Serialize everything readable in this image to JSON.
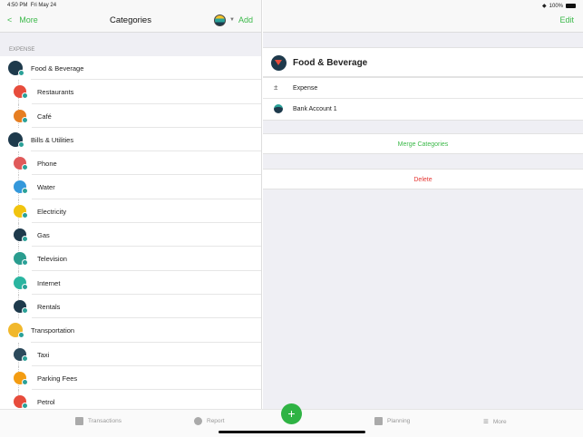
{
  "status": {
    "time": "4:50 PM",
    "date": "Fri May 24",
    "battery": "100%"
  },
  "nav": {
    "back_label": "More",
    "title": "Categories",
    "add_label": "Add",
    "edit_label": "Edit"
  },
  "section_label": "EXPENSE",
  "categories": [
    {
      "label": "Food & Beverage",
      "level": "parent",
      "color": "#1e3a4c"
    },
    {
      "label": "Restaurants",
      "level": "child",
      "color": "#e74c3c"
    },
    {
      "label": "Café",
      "level": "child",
      "color": "#e67e22"
    },
    {
      "label": "Bills & Utilities",
      "level": "parent",
      "color": "#1e3a4c"
    },
    {
      "label": "Phone",
      "level": "child",
      "color": "#e05a5a"
    },
    {
      "label": "Water",
      "level": "child",
      "color": "#3498db"
    },
    {
      "label": "Electricity",
      "level": "child",
      "color": "#f1c40f"
    },
    {
      "label": "Gas",
      "level": "child",
      "color": "#1e3a4c"
    },
    {
      "label": "Television",
      "level": "child",
      "color": "#2a9d8f"
    },
    {
      "label": "Internet",
      "level": "child",
      "color": "#2ab5a0"
    },
    {
      "label": "Rentals",
      "level": "child",
      "color": "#1e3a4c"
    },
    {
      "label": "Transportation",
      "level": "parent",
      "color": "#f1b82c"
    },
    {
      "label": "Taxi",
      "level": "child",
      "color": "#2c4a5c"
    },
    {
      "label": "Parking Fees",
      "level": "child",
      "color": "#f39c12"
    },
    {
      "label": "Petrol",
      "level": "child",
      "color": "#e74c3c"
    }
  ],
  "detail": {
    "title": "Food & Beverage",
    "type": "Expense",
    "account": "Bank Account 1",
    "merge_label": "Merge Categories",
    "delete_label": "Delete"
  },
  "tabs": [
    {
      "label": "Transactions"
    },
    {
      "label": "Report"
    },
    {
      "label": "Planning"
    },
    {
      "label": "More"
    }
  ],
  "fab_label": "+"
}
